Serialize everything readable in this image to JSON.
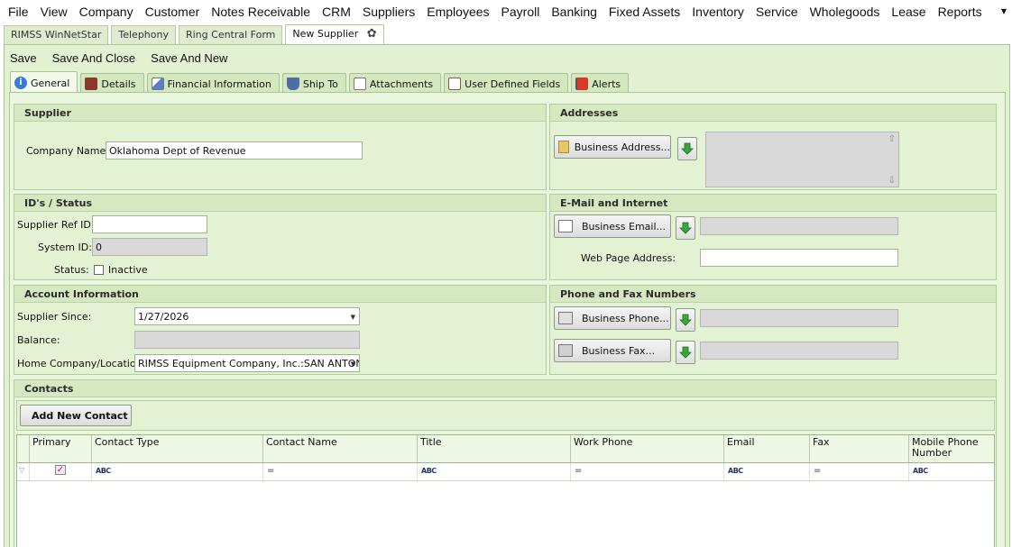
{
  "menu": [
    "File",
    "View",
    "Company",
    "Customer",
    "Notes Receivable",
    "CRM",
    "Suppliers",
    "Employees",
    "Payroll",
    "Banking",
    "Fixed Assets",
    "Inventory",
    "Service",
    "Wholegoods",
    "Lease",
    "Reports"
  ],
  "doc_tabs": [
    "RIMSS WinNetStar",
    "Telephony",
    "Ring Central Form",
    "New Supplier"
  ],
  "toolbar": {
    "save": "Save",
    "save_close": "Save And Close",
    "save_new": "Save And New"
  },
  "sub_tabs": [
    "General",
    "Details",
    "Financial Information",
    "Ship To",
    "Attachments",
    "User Defined Fields",
    "Alerts"
  ],
  "supplier": {
    "title": "Supplier",
    "company_name_label": "Company Name:",
    "company_name": "Oklahoma Dept of Revenue"
  },
  "addresses": {
    "title": "Addresses",
    "button": "Business Address..."
  },
  "ids": {
    "title": "ID's / Status",
    "ref_label": "Supplier Ref ID:",
    "ref_value": "",
    "system_label": "System ID:",
    "system_value": "0",
    "status_label": "Status:",
    "inactive_label": "Inactive"
  },
  "email": {
    "title": "E-Mail and Internet",
    "button": "Business Email...",
    "web_label": "Web Page Address:"
  },
  "account": {
    "title": "Account Information",
    "since_label": "Supplier Since:",
    "since_value": "1/27/2026",
    "balance_label": "Balance:",
    "home_label": "Home Company/Location:",
    "home_value": "RIMSS Equipment Company, Inc.:SAN ANTON..."
  },
  "phone": {
    "title": "Phone and Fax Numbers",
    "phone_button": "Business Phone...",
    "fax_button": "Business Fax..."
  },
  "contacts": {
    "title": "Contacts",
    "add_button": "Add New Contact",
    "columns": [
      "Primary",
      "Contact Type",
      "Contact Name",
      "Title",
      "Work Phone",
      "Email",
      "Fax",
      "Mobile Phone Number"
    ]
  }
}
